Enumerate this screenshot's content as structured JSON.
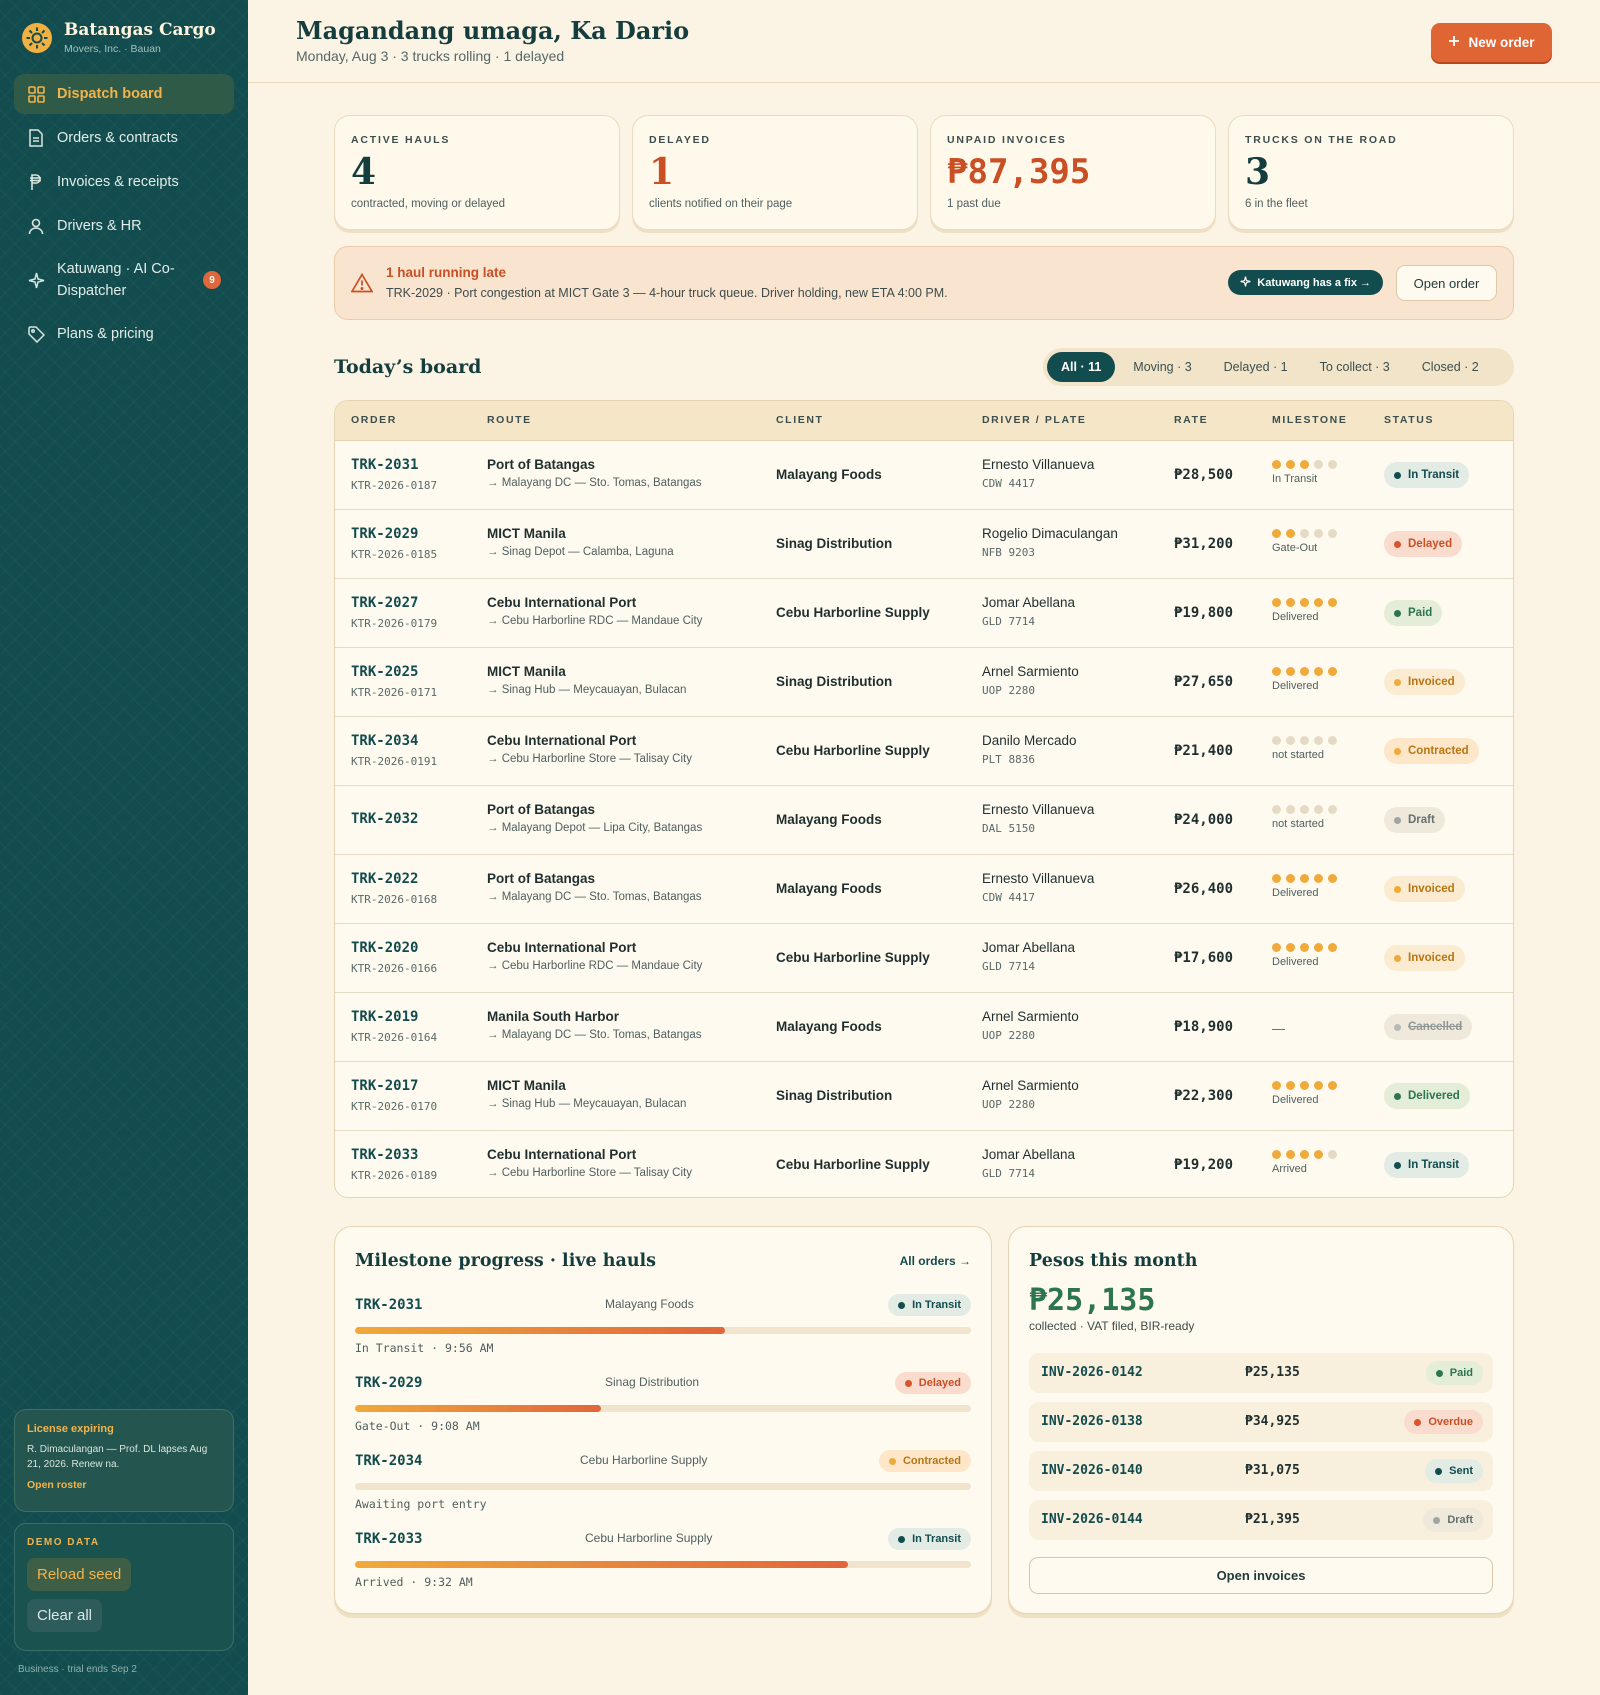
{
  "brand": {
    "name": "Batangas Cargo",
    "sub": "Movers, Inc. · Bauan"
  },
  "nav": [
    {
      "label": "Dispatch board",
      "icon": "grid-icon",
      "active": true
    },
    {
      "label": "Orders & contracts",
      "icon": "document-icon"
    },
    {
      "label": "Invoices & receipts",
      "icon": "peso-icon"
    },
    {
      "label": "Drivers & HR",
      "icon": "user-icon"
    },
    {
      "label": "Katuwang · AI Co-Dispatcher",
      "icon": "sparkle-icon",
      "badge": "9"
    },
    {
      "label": "Plans & pricing",
      "icon": "tag-icon"
    }
  ],
  "license": {
    "title": "License expiring",
    "text": "R. Dimaculangan — Prof. DL lapses Aug 21, 2026. Renew na.",
    "link": "Open roster"
  },
  "demo": {
    "title": "DEMO DATA",
    "reload": "Reload seed",
    "clear": "Clear all"
  },
  "footer_note": "Business · trial ends Sep 2",
  "header": {
    "greeting": "Magandang umaga, Ka Dario",
    "sub": "Monday, Aug 3 · 3 trucks rolling · 1 delayed",
    "new_order": "New order"
  },
  "kpis": [
    {
      "label": "ACTIVE HAULS",
      "value": "4",
      "sub": "contracted, moving or delayed"
    },
    {
      "label": "DELAYED",
      "value": "1",
      "sub": "clients notified on their page"
    },
    {
      "label": "UNPAID INVOICES",
      "value": "₱87,395",
      "sub": "1 past due"
    },
    {
      "label": "TRUCKS ON THE ROAD",
      "value": "3",
      "sub": "6 in the fleet"
    }
  ],
  "alert": {
    "title": "1 haul running late",
    "text": "TRK-2029 · Port congestion at MICT Gate 3 — 4-hour truck queue. Driver holding, new ETA 4:00 PM.",
    "fix_label": "Katuwang has a fix →",
    "open_label": "Open order"
  },
  "board": {
    "title": "Today’s board",
    "filters": [
      "All · 11",
      "Moving · 3",
      "Delayed · 1",
      "To collect · 3",
      "Closed · 2"
    ],
    "columns": [
      "ORDER",
      "ROUTE",
      "CLIENT",
      "DRIVER / PLATE",
      "RATE",
      "MILESTONE",
      "STATUS"
    ],
    "rows": [
      {
        "id": "TRK-2031",
        "ktr": "KTR-2026-0187",
        "route": "Port of Batangas",
        "dest": "→ Malayang DC — Sto. Tomas, Batangas",
        "client": "Malayang Foods",
        "driver": "Ernesto Villanueva",
        "plate": "CDW 4417",
        "rate": "₱28,500",
        "ms_done": 3,
        "ms_label": "In Transit",
        "status": "In Transit",
        "status_key": "in-transit"
      },
      {
        "id": "TRK-2029",
        "ktr": "KTR-2026-0185",
        "route": "MICT Manila",
        "dest": "→ Sinag Depot — Calamba, Laguna",
        "client": "Sinag Distribution",
        "driver": "Rogelio Dimaculangan",
        "plate": "NFB 9203",
        "rate": "₱31,200",
        "ms_done": 2,
        "ms_label": "Gate-Out",
        "status": "Delayed",
        "status_key": "delayed"
      },
      {
        "id": "TRK-2027",
        "ktr": "KTR-2026-0179",
        "route": "Cebu International Port",
        "dest": "→ Cebu Harborline RDC — Mandaue City",
        "client": "Cebu Harborline Supply",
        "driver": "Jomar Abellana",
        "plate": "GLD 7714",
        "rate": "₱19,800",
        "ms_done": 5,
        "ms_label": "Delivered",
        "status": "Paid",
        "status_key": "paid"
      },
      {
        "id": "TRK-2025",
        "ktr": "KTR-2026-0171",
        "route": "MICT Manila",
        "dest": "→ Sinag Hub — Meycauayan, Bulacan",
        "client": "Sinag Distribution",
        "driver": "Arnel Sarmiento",
        "plate": "UOP 2280",
        "rate": "₱27,650",
        "ms_done": 5,
        "ms_label": "Delivered",
        "status": "Invoiced",
        "status_key": "invoiced"
      },
      {
        "id": "TRK-2034",
        "ktr": "KTR-2026-0191",
        "route": "Cebu International Port",
        "dest": "→ Cebu Harborline Store — Talisay City",
        "client": "Cebu Harborline Supply",
        "driver": "Danilo Mercado",
        "plate": "PLT 8836",
        "rate": "₱21,400",
        "ms_done": 0,
        "ms_label": "not started",
        "status": "Contracted",
        "status_key": "contracted"
      },
      {
        "id": "TRK-2032",
        "ktr": "",
        "route": "Port of Batangas",
        "dest": "→ Malayang Depot — Lipa City, Batangas",
        "client": "Malayang Foods",
        "driver": "Ernesto Villanueva",
        "plate": "DAL 5150",
        "rate": "₱24,000",
        "ms_done": 0,
        "ms_label": "not started",
        "status": "Draft",
        "status_key": "draft"
      },
      {
        "id": "TRK-2022",
        "ktr": "KTR-2026-0168",
        "route": "Port of Batangas",
        "dest": "→ Malayang DC — Sto. Tomas, Batangas",
        "client": "Malayang Foods",
        "driver": "Ernesto Villanueva",
        "plate": "CDW 4417",
        "rate": "₱26,400",
        "ms_done": 5,
        "ms_label": "Delivered",
        "status": "Invoiced",
        "status_key": "invoiced"
      },
      {
        "id": "TRK-2020",
        "ktr": "KTR-2026-0166",
        "route": "Cebu International Port",
        "dest": "→ Cebu Harborline RDC — Mandaue City",
        "client": "Cebu Harborline Supply",
        "driver": "Jomar Abellana",
        "plate": "GLD 7714",
        "rate": "₱17,600",
        "ms_done": 5,
        "ms_label": "Delivered",
        "status": "Invoiced",
        "status_key": "invoiced"
      },
      {
        "id": "TRK-2019",
        "ktr": "KTR-2026-0164",
        "route": "Manila South Harbor",
        "dest": "→ Malayang DC — Sto. Tomas, Batangas",
        "client": "Malayang Foods",
        "driver": "Arnel Sarmiento",
        "plate": "UOP 2280",
        "rate": "₱18,900",
        "ms_done": -1,
        "ms_label": "—",
        "status": "Cancelled",
        "status_key": "cancelled"
      },
      {
        "id": "TRK-2017",
        "ktr": "KTR-2026-0170",
        "route": "MICT Manila",
        "dest": "→ Sinag Hub — Meycauayan, Bulacan",
        "client": "Sinag Distribution",
        "driver": "Arnel Sarmiento",
        "plate": "UOP 2280",
        "rate": "₱22,300",
        "ms_done": 5,
        "ms_label": "Delivered",
        "status": "Delivered",
        "status_key": "delivered"
      },
      {
        "id": "TRK-2033",
        "ktr": "KTR-2026-0189",
        "route": "Cebu International Port",
        "dest": "→ Cebu Harborline Store — Talisay City",
        "client": "Cebu Harborline Supply",
        "driver": "Jomar Abellana",
        "plate": "GLD 7714",
        "rate": "₱19,200",
        "ms_done": 4,
        "ms_label": "Arrived",
        "status": "In Transit",
        "status_key": "in-transit"
      }
    ]
  },
  "milestones": {
    "title": "Milestone progress · live hauls",
    "link": "All orders →",
    "items": [
      {
        "id": "TRK-2031",
        "client": "Malayang Foods",
        "status": "In Transit",
        "status_key": "in-transit",
        "progress": 0.6,
        "note": "In Transit · 9:56 AM"
      },
      {
        "id": "TRK-2029",
        "client": "Sinag Distribution",
        "status": "Delayed",
        "status_key": "delayed",
        "progress": 0.4,
        "note": "Gate-Out · 9:08 AM"
      },
      {
        "id": "TRK-2034",
        "client": "Cebu Harborline Supply",
        "status": "Contracted",
        "status_key": "contracted",
        "progress": 0,
        "note": "Awaiting port entry"
      },
      {
        "id": "TRK-2033",
        "client": "Cebu Harborline Supply",
        "status": "In Transit",
        "status_key": "in-transit",
        "progress": 0.8,
        "note": "Arrived · 9:32 AM"
      }
    ]
  },
  "pesos": {
    "title": "Pesos this month",
    "value": "₱25,135",
    "sub": "collected · VAT filed, BIR-ready",
    "invoices": [
      {
        "id": "INV-2026-0142",
        "amount": "₱25,135",
        "status": "Paid",
        "status_key": "paid"
      },
      {
        "id": "INV-2026-0138",
        "amount": "₱34,925",
        "status": "Overdue",
        "status_key": "overdue"
      },
      {
        "id": "INV-2026-0140",
        "amount": "₱31,075",
        "status": "Sent",
        "status_key": "sent"
      },
      {
        "id": "INV-2026-0144",
        "amount": "₱21,395",
        "status": "Draft",
        "status_key": "draft"
      }
    ],
    "open_label": "Open invoices"
  }
}
